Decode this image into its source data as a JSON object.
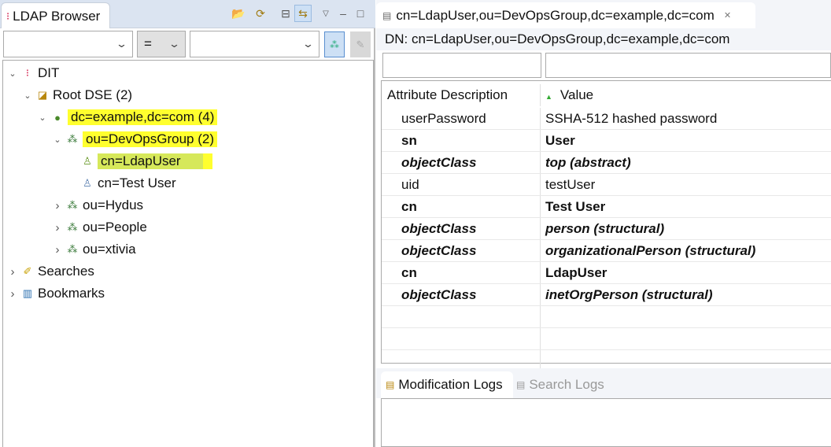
{
  "left_panel": {
    "tab_title": "LDAP Browser",
    "filter": {
      "attribute_value": "",
      "operator": "=",
      "value": ""
    },
    "tree": [
      {
        "label": "DIT",
        "level": 0,
        "expanded": true,
        "icon": "dit-icon",
        "highlight": false
      },
      {
        "label": "Root DSE (2)",
        "level": 1,
        "expanded": true,
        "icon": "root-dse-icon",
        "highlight": false
      },
      {
        "label": "dc=example,dc=com (4)",
        "level": 2,
        "expanded": true,
        "icon": "globe-icon",
        "highlight": true
      },
      {
        "label": "ou=DevOpsGroup (2)",
        "level": 3,
        "expanded": true,
        "icon": "org-unit-icon",
        "highlight": true
      },
      {
        "label": "cn=LdapUser",
        "level": 4,
        "icon": "user-icon",
        "highlight": true,
        "selected": true
      },
      {
        "label": "cn=Test User",
        "level": 4,
        "icon": "user-icon",
        "highlight": false
      },
      {
        "label": "ou=Hydus",
        "level": 3,
        "expanded": false,
        "icon": "org-unit-icon",
        "highlight": false
      },
      {
        "label": "ou=People",
        "level": 3,
        "expanded": false,
        "icon": "org-unit-icon",
        "highlight": false
      },
      {
        "label": "ou=xtivia",
        "level": 3,
        "expanded": false,
        "icon": "org-unit-icon",
        "highlight": false
      },
      {
        "label": "Searches",
        "level": 0,
        "expanded": false,
        "icon": "searches-icon",
        "highlight": false
      },
      {
        "label": "Bookmarks",
        "level": 0,
        "expanded": false,
        "icon": "bookmarks-icon",
        "highlight": false
      }
    ]
  },
  "editor": {
    "tab_title": "cn=LdapUser,ou=DevOpsGroup,dc=example,dc=com",
    "dn": "DN: cn=LdapUser,ou=DevOpsGroup,dc=example,dc=com",
    "columns": [
      "Attribute Description",
      "Value"
    ],
    "rows": [
      {
        "attr": "userPassword",
        "value": "SSHA-512 hashed password",
        "style": "normal"
      },
      {
        "attr": "sn",
        "value": "User",
        "style": "bold"
      },
      {
        "attr": "objectClass",
        "value": "top (abstract)",
        "style": "bold-italic"
      },
      {
        "attr": "uid",
        "value": "testUser",
        "style": "normal"
      },
      {
        "attr": "cn",
        "value": "Test User",
        "style": "bold"
      },
      {
        "attr": "objectClass",
        "value": "person (structural)",
        "style": "bold-italic"
      },
      {
        "attr": "objectClass",
        "value": "organizationalPerson (structural)",
        "style": "bold-italic"
      },
      {
        "attr": "cn",
        "value": "LdapUser",
        "style": "bold"
      },
      {
        "attr": "objectClass",
        "value": "inetOrgPerson (structural)",
        "style": "bold-italic"
      }
    ]
  },
  "bottom": {
    "tabs": [
      "Modification Logs",
      "Search Logs"
    ]
  },
  "colors": {
    "highlight": "#ffff2e",
    "selection": "#cde8ff"
  }
}
